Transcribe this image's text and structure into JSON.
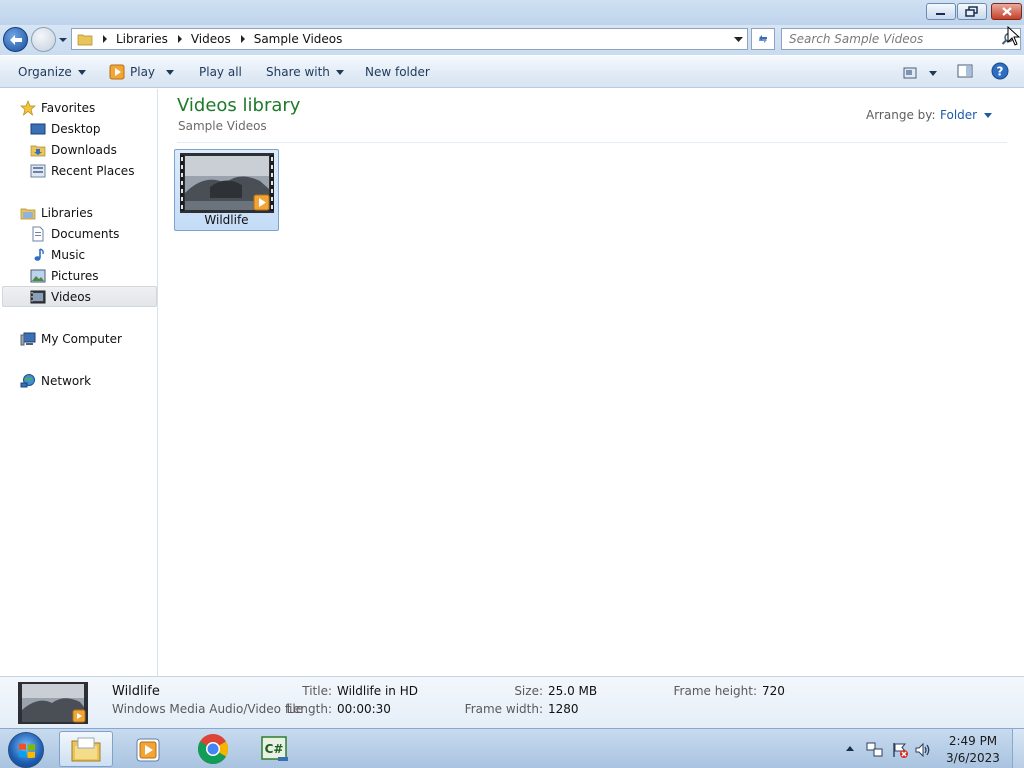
{
  "address": {
    "crumbs": [
      "Libraries",
      "Videos",
      "Sample Videos"
    ],
    "search_placeholder": "Search Sample Videos"
  },
  "toolbar": {
    "organize": "Organize",
    "play": "Play",
    "play_all": "Play all",
    "share_with": "Share with",
    "new_folder": "New folder"
  },
  "nav": {
    "favorites": "Favorites",
    "desktop": "Desktop",
    "downloads": "Downloads",
    "recent_places": "Recent Places",
    "libraries": "Libraries",
    "documents": "Documents",
    "music": "Music",
    "pictures": "Pictures",
    "videos": "Videos",
    "my_computer": "My Computer",
    "network": "Network"
  },
  "content": {
    "title": "Videos library",
    "subtitle": "Sample Videos",
    "arrange_label": "Arrange by:",
    "arrange_value": "Folder",
    "items": [
      {
        "name": "Wildlife"
      }
    ]
  },
  "details": {
    "name": "Wildlife",
    "type": "Windows Media Audio/Video file",
    "title_label": "Title:",
    "title_value": "Wildlife in HD",
    "length_label": "Length:",
    "length_value": "00:00:30",
    "size_label": "Size:",
    "size_value": "25.0 MB",
    "frame_width_label": "Frame width:",
    "frame_width_value": "1280",
    "frame_height_label": "Frame height:",
    "frame_height_value": "720"
  },
  "taskbar": {
    "time": "2:49 PM",
    "date": "3/6/2023",
    "pinned": [
      "windows-explorer",
      "windows-media-player",
      "chrome",
      "csharp-editor"
    ]
  },
  "colors": {
    "library_title": "#1e7a2a",
    "link_blue": "#1d5aa8",
    "selection": "#c4dcf7"
  }
}
